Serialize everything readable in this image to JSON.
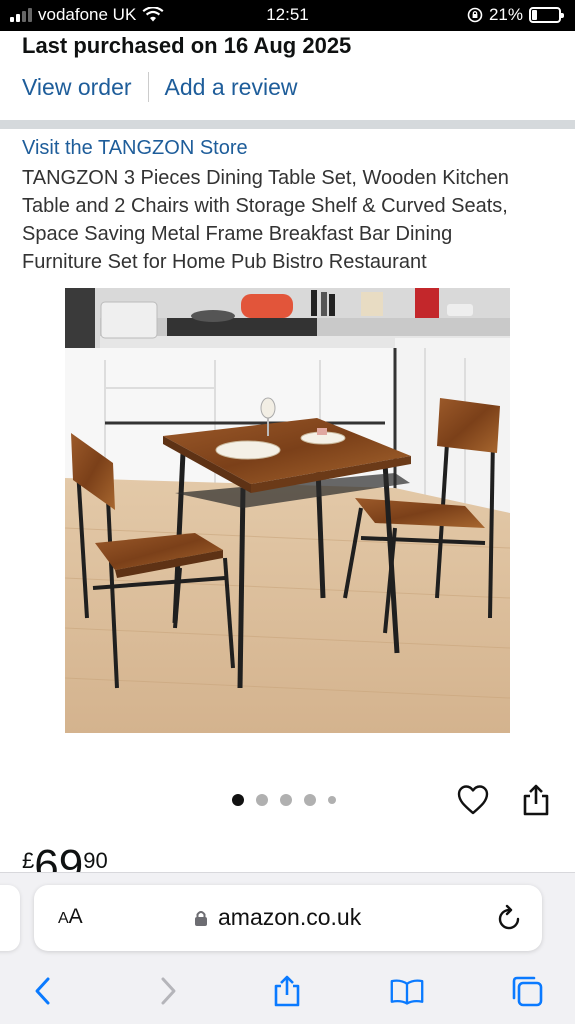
{
  "status_bar": {
    "carrier": "vodafone UK",
    "time": "12:51",
    "battery_percent_text": "21%",
    "battery_level": 0.21
  },
  "order": {
    "last_purchased": "Last purchased on 16 Aug 2025",
    "view_order_label": "View order",
    "add_review_label": "Add a review"
  },
  "product": {
    "store_link": "Visit the TANGZON Store",
    "title_lines": [
      "TANGZON 3 Pieces Dining Table Set, Wooden Kitchen",
      "Table and 2 Chairs with Storage Shelf & Curved Seats,",
      "Space Saving Metal Frame Breakfast Bar Dining",
      "Furniture Set for Home Pub Bistro Restaurant"
    ],
    "image": "dining-table-set-photo",
    "carousel": {
      "count": 5,
      "active_index": 0
    },
    "price": {
      "symbol": "£",
      "whole": "69",
      "fraction": "90"
    }
  },
  "icons": {
    "wishlist": "heart-icon",
    "share": "share-icon"
  },
  "browser": {
    "text_size_label_small": "A",
    "text_size_label_large": "A",
    "url": "amazon.co.uk",
    "toolbar": [
      "back-icon",
      "forward-icon",
      "share-icon",
      "bookmarks-icon",
      "tabs-icon"
    ]
  },
  "colors": {
    "link": "#1e5d9a",
    "ios_blue": "#0a7aff",
    "divider": "#d5d9dc"
  }
}
